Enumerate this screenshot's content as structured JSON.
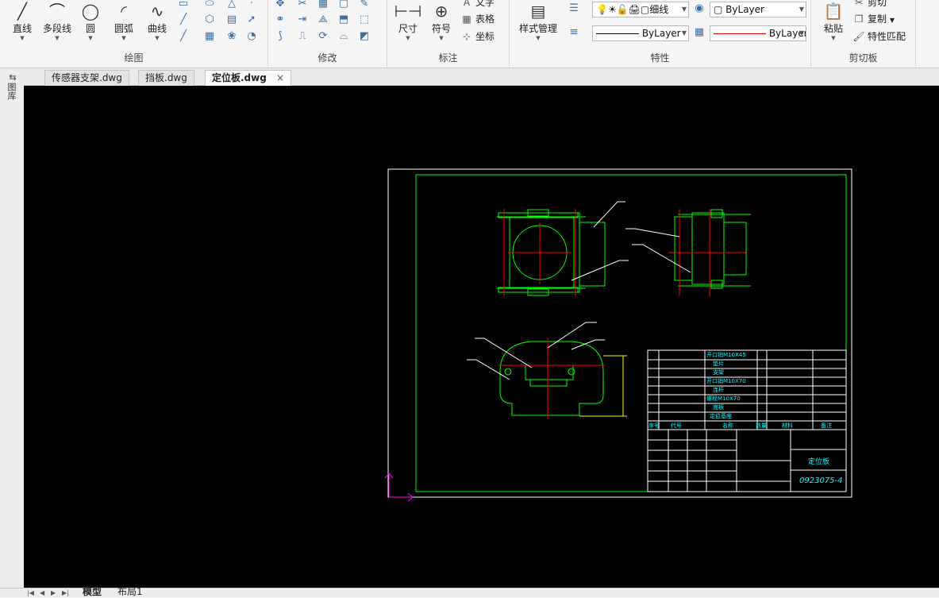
{
  "ribbon": {
    "draw": {
      "title": "绘图",
      "line": "直线",
      "polyline": "多段线",
      "circle": "圆",
      "arc": "圆弧",
      "spline": "曲线"
    },
    "modify": {
      "title": "修改"
    },
    "annotate": {
      "title": "标注",
      "dimension": "尺寸",
      "symbol": "符号",
      "text": "文字",
      "table": "表格",
      "coordinate": "坐标"
    },
    "properties": {
      "title": "特性",
      "style_manager": "样式管理",
      "line_weight": "细线",
      "layer_color": "ByLayer",
      "linetype": "ByLayer",
      "line_color": "ByLayer"
    },
    "clipboard": {
      "title": "剪切板",
      "paste": "粘贴",
      "cut": "剪切",
      "copy": "复制",
      "match_props": "特性匹配"
    }
  },
  "tabs": [
    {
      "label": "传感器支架.dwg"
    },
    {
      "label": "挡板.dwg"
    },
    {
      "label": "定位板.dwg",
      "close": "×"
    }
  ],
  "sidebar": {
    "label": "图库"
  },
  "layout_tabs": [
    {
      "label": "模型"
    },
    {
      "label": "布局1"
    }
  ],
  "drawing": {
    "parts_list": [
      "开口销M10X45",
      "垫片",
      "支架",
      "开口销M10X70",
      "连杆",
      "螺栓M10X70",
      "底板",
      "定位基座"
    ],
    "header_cells": [
      "序号",
      "代号",
      "名称",
      "数量",
      "材料",
      "备注"
    ],
    "title_block_name": "定位板",
    "drawing_number": "0923075-4"
  },
  "colors": {
    "canvas_bg": "#000000",
    "geometry": "#00ff00",
    "centerline": "#ff0000",
    "annotation": "#00ffff",
    "leader": "#ffffff",
    "dimension": "#ffff00",
    "ucs": "#ff00ff"
  }
}
